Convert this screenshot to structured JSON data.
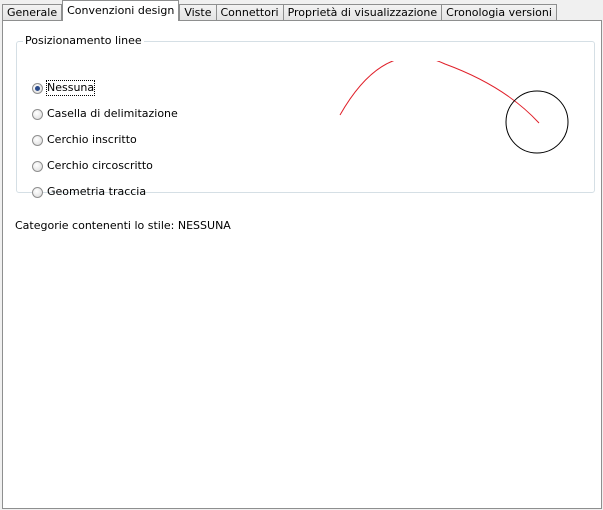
{
  "tabs": [
    {
      "label": "Generale"
    },
    {
      "label": "Convenzioni design"
    },
    {
      "label": "Viste"
    },
    {
      "label": "Connettori"
    },
    {
      "label": "Proprietà di visualizzazione"
    },
    {
      "label": "Cronologia versioni"
    }
  ],
  "active_tab": "Convenzioni design",
  "group": {
    "title": "Posizionamento linee",
    "options": [
      {
        "label": "Nessuna",
        "checked": true
      },
      {
        "label": "Casella di delimitazione",
        "checked": false
      },
      {
        "label": "Cerchio inscritto",
        "checked": false
      },
      {
        "label": "Cerchio circoscritto",
        "checked": false
      },
      {
        "label": "Geometria traccia",
        "checked": false
      }
    ]
  },
  "preview": {
    "arc_color": "#e0202a",
    "circle_color": "#000000"
  },
  "status_text": "Categorie contenenti lo stile: NESSUNA"
}
